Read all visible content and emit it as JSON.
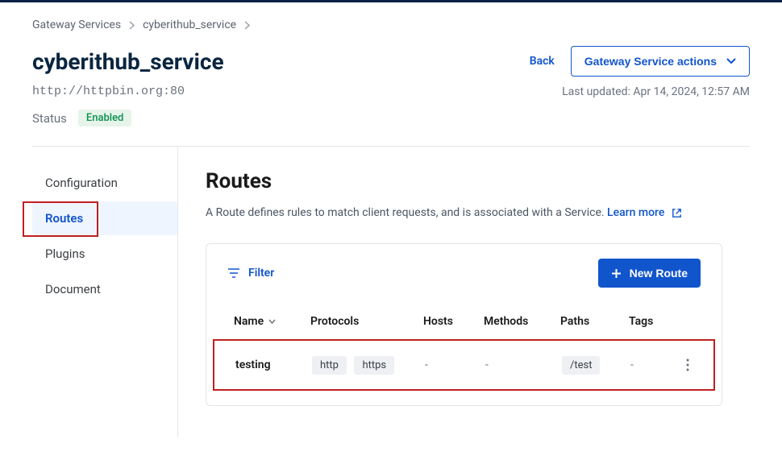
{
  "breadcrumb": {
    "root": "Gateway Services",
    "current": "cyberithub_service"
  },
  "header": {
    "title": "cyberithub_service",
    "back_label": "Back",
    "actions_label": "Gateway Service actions",
    "service_url": "http://httpbin.org:80",
    "last_updated": "Last updated: Apr 14, 2024, 12:57 AM",
    "status_label": "Status",
    "status_value": "Enabled"
  },
  "sidebar": {
    "configuration": "Configuration",
    "routes": "Routes",
    "plugins": "Plugins",
    "document": "Document"
  },
  "main": {
    "title": "Routes",
    "description": "A Route defines rules to match client requests, and is associated with a Service.",
    "learn_more": "Learn more",
    "filter_label": "Filter",
    "new_route_label": "New Route"
  },
  "table": {
    "columns": {
      "name": "Name",
      "protocols": "Protocols",
      "hosts": "Hosts",
      "methods": "Methods",
      "paths": "Paths",
      "tags": "Tags"
    },
    "rows": [
      {
        "name": "testing",
        "protocols": [
          "http",
          "https"
        ],
        "hosts": "-",
        "methods": "-",
        "paths": [
          "/test"
        ],
        "tags": "-"
      }
    ]
  }
}
